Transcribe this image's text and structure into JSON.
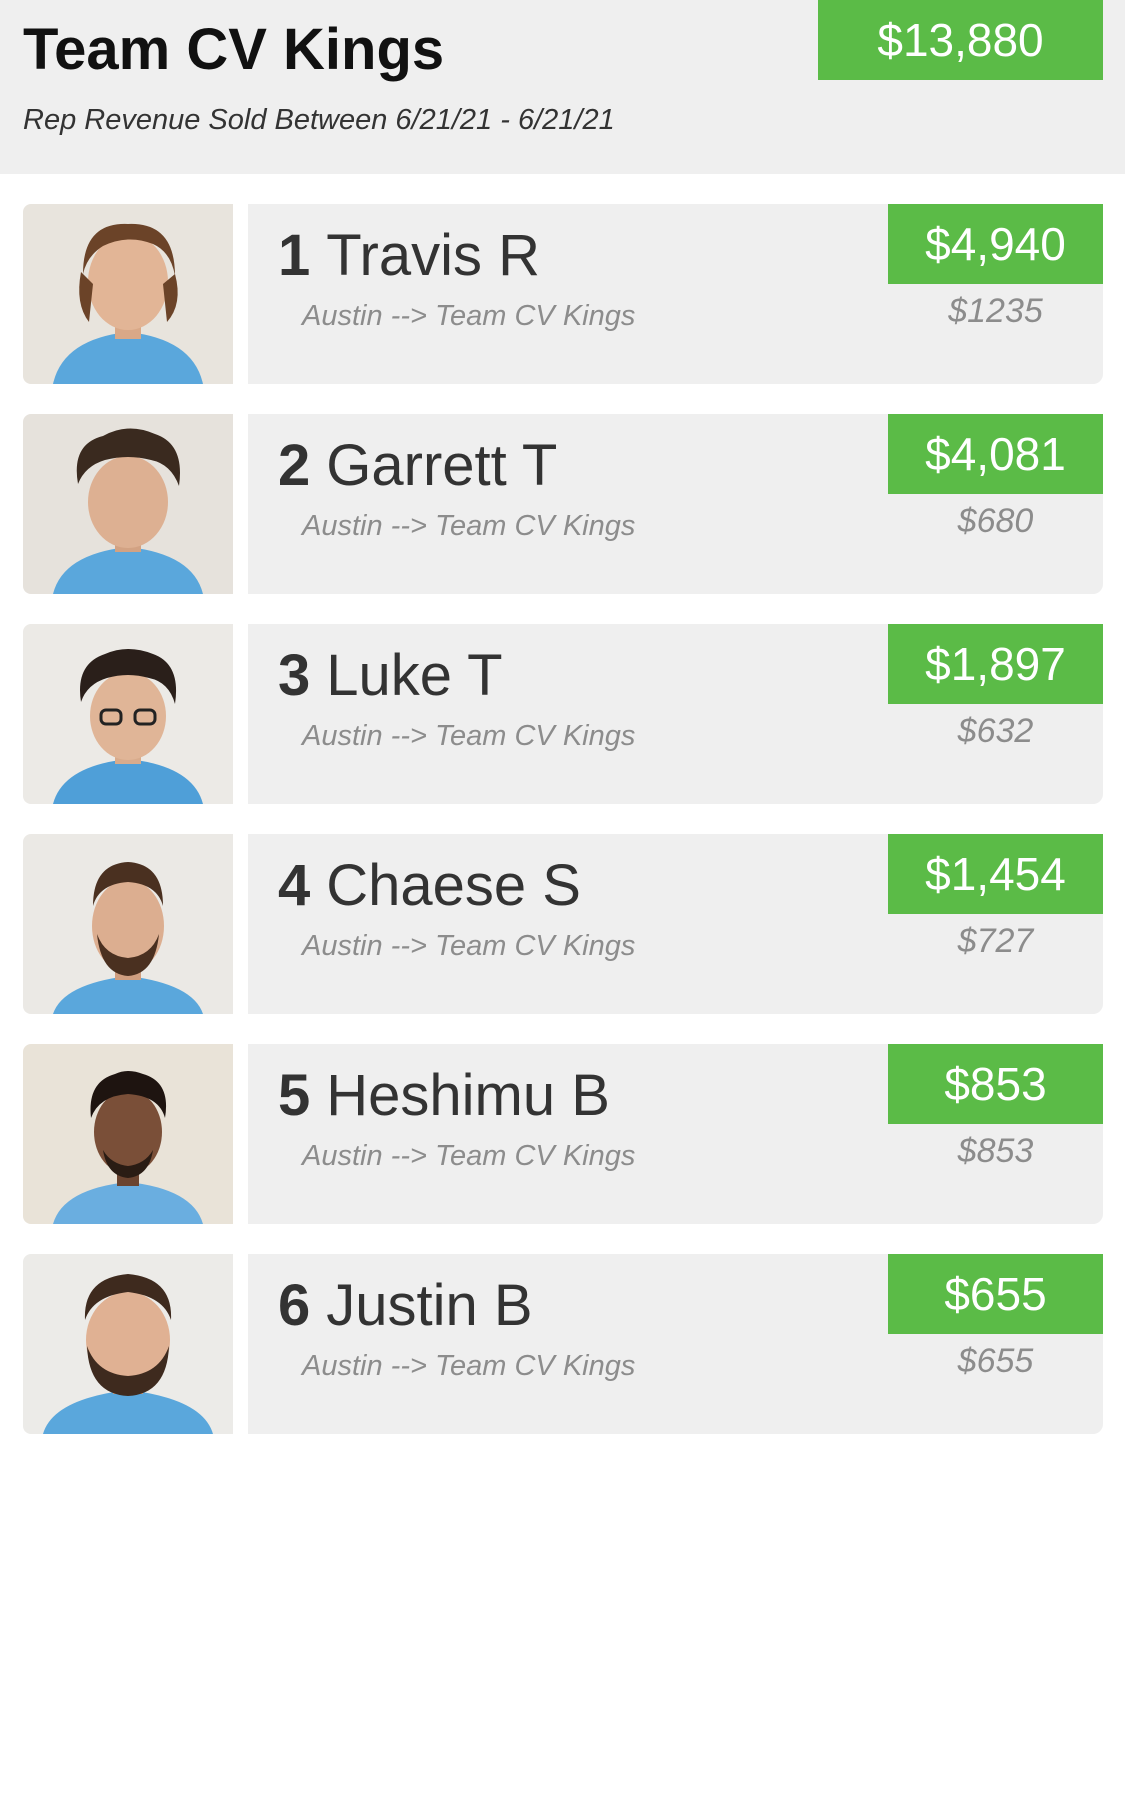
{
  "header": {
    "title": "Team CV Kings",
    "date_range": "Rep Revenue Sold Between 6/21/21 - 6/21/21",
    "total": "$13,880"
  },
  "colors": {
    "accent_green": "#5bbb47",
    "card_bg": "#efefef",
    "shirt_blue": "#5aa7dc"
  },
  "reps": [
    {
      "rank": "1",
      "name": "Travis R",
      "route": "Austin --> Team CV Kings",
      "amount": "$4,940",
      "sub_amount": "$1235",
      "photo": "rep-photo-icon"
    },
    {
      "rank": "2",
      "name": "Garrett T",
      "route": "Austin --> Team CV Kings",
      "amount": "$4,081",
      "sub_amount": "$680",
      "photo": "rep-photo-icon"
    },
    {
      "rank": "3",
      "name": "Luke T",
      "route": "Austin --> Team CV Kings",
      "amount": "$1,897",
      "sub_amount": "$632",
      "photo": "rep-photo-icon"
    },
    {
      "rank": "4",
      "name": "Chaese S",
      "route": "Austin --> Team CV Kings",
      "amount": "$1,454",
      "sub_amount": "$727",
      "photo": "rep-photo-icon"
    },
    {
      "rank": "5",
      "name": "Heshimu B",
      "route": "Austin --> Team CV Kings",
      "amount": "$853",
      "sub_amount": "$853",
      "photo": "rep-photo-icon"
    },
    {
      "rank": "6",
      "name": "Justin B",
      "route": "Austin --> Team CV Kings",
      "amount": "$655",
      "sub_amount": "$655",
      "photo": "rep-photo-icon"
    }
  ]
}
